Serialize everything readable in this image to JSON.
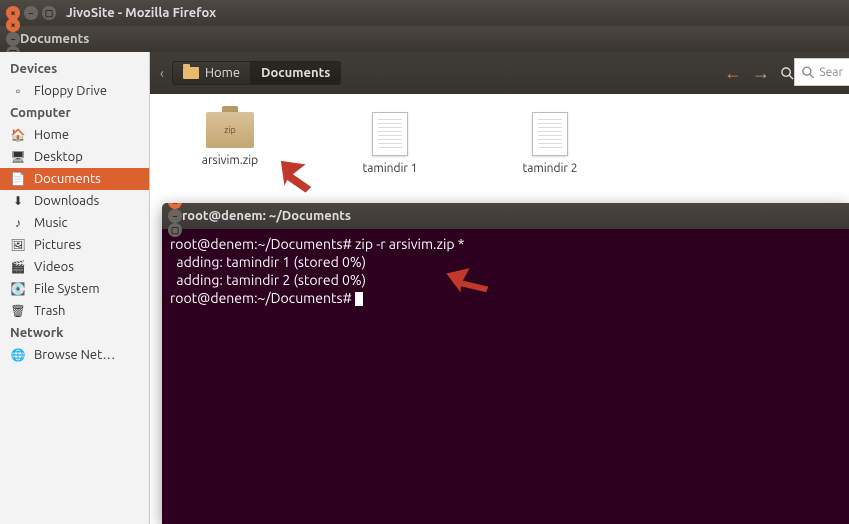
{
  "firefox_title": "JivoSite - Mozilla Firefox",
  "fm_title": "Documents",
  "breadcrumb": {
    "home": "Home",
    "current": "Documents"
  },
  "nav": {
    "search_label": "Search"
  },
  "searchbox": {
    "placeholder": "Sear"
  },
  "sidebar": {
    "sections": {
      "devices": "Devices",
      "computer": "Computer",
      "network": "Network"
    },
    "items": {
      "floppy": "Floppy Drive",
      "home": "Home",
      "desktop": "Desktop",
      "documents": "Documents",
      "downloads": "Downloads",
      "music": "Music",
      "pictures": "Pictures",
      "videos": "Videos",
      "filesystem": "File System",
      "trash": "Trash",
      "browse_net": "Browse Net…"
    }
  },
  "files": [
    {
      "name": "arsivim.zip",
      "type": "zip"
    },
    {
      "name": "tamindir 1",
      "type": "text"
    },
    {
      "name": "tamindir 2",
      "type": "text"
    }
  ],
  "zip_badge": "zip",
  "terminal": {
    "title": "root@denem: ~/Documents",
    "lines": [
      "root@denem:~/Documents# zip -r arsivim.zip *",
      "  adding: tamindir 1 (stored 0%)",
      "  adding: tamindir 2 (stored 0%)",
      "root@denem:~/Documents# "
    ]
  },
  "search_icon_hint": "🔍"
}
